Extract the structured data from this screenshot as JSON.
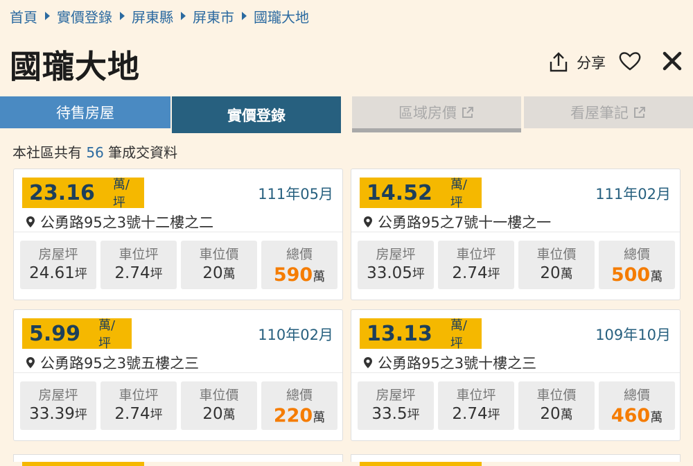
{
  "breadcrumb": [
    "首頁",
    "實價登錄",
    "屏東縣",
    "屏東市",
    "國瓏大地"
  ],
  "title": "國瓏大地",
  "actions": {
    "share_label": "分享"
  },
  "tabs": [
    "待售房屋",
    "實價登錄",
    "區域房價",
    "看屋筆記"
  ],
  "summary": {
    "prefix": "本社區共有",
    "count": "56",
    "suffix": "筆成交資料"
  },
  "stat_labels": [
    "房屋坪",
    "車位坪",
    "車位價",
    "總價"
  ],
  "units": {
    "price": "萬/坪",
    "ping": "坪",
    "wan": "萬"
  },
  "colors": {
    "accent": "#f5b800",
    "total": "#f57c00",
    "link": "#2b6aa0",
    "active_tab": "#27607f"
  },
  "cards": [
    {
      "price": "23.16",
      "date": "111年05月",
      "address": "公勇路95之3號十二樓之二",
      "house": "24.61",
      "parking_area": "2.74",
      "parking_price": "20",
      "total": "590"
    },
    {
      "price": "14.52",
      "date": "111年02月",
      "address": "公勇路95之7號十一樓之一",
      "house": "33.05",
      "parking_area": "2.74",
      "parking_price": "20",
      "total": "500"
    },
    {
      "price": "5.99",
      "date": "110年02月",
      "address": "公勇路95之3號五樓之三",
      "house": "33.39",
      "parking_area": "2.74",
      "parking_price": "20",
      "total": "220"
    },
    {
      "price": "13.13",
      "date": "109年10月",
      "address": "公勇路95之3號十樓之三",
      "house": "33.5",
      "parking_area": "2.74",
      "parking_price": "20",
      "total": "460"
    }
  ]
}
